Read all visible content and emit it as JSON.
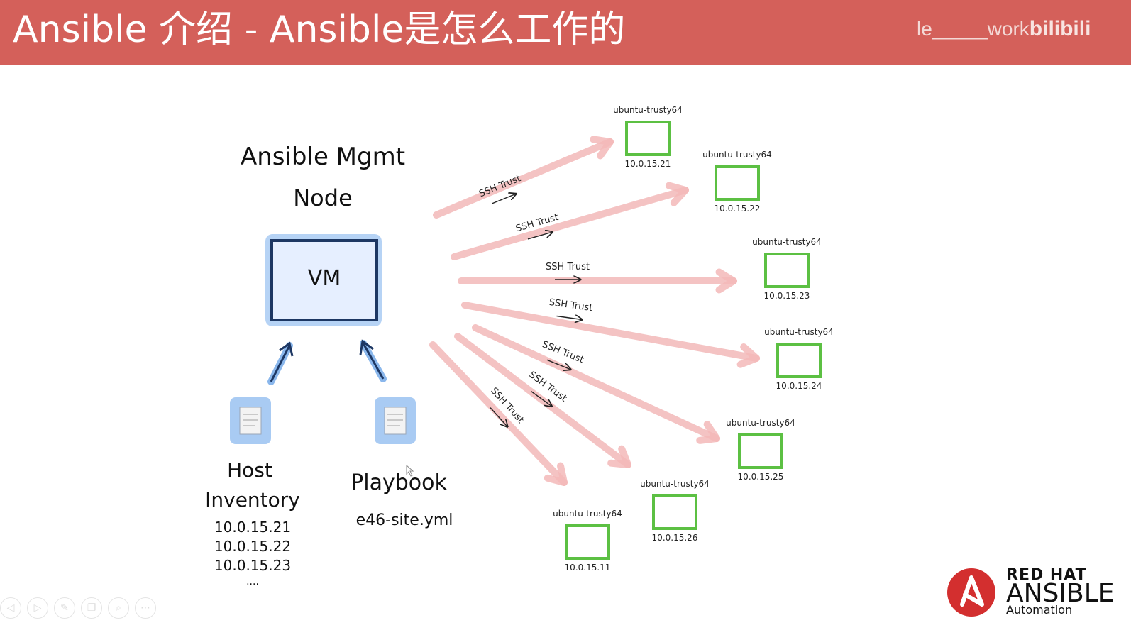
{
  "header": {
    "title": "Ansible 介绍 - Ansible是怎么工作的",
    "watermark_user": "le_____work",
    "watermark_site": "bilibili"
  },
  "diagram": {
    "mgmt_label_line1": "Ansible Mgmt",
    "mgmt_label_line2": "Node",
    "vm_label": "VM",
    "inventory": {
      "label_line1": "Host",
      "label_line2": "Inventory",
      "hosts": [
        "10.0.15.21",
        "10.0.15.22",
        "10.0.15.23",
        "...."
      ]
    },
    "playbook": {
      "label": "Playbook",
      "file": "e46-site.yml"
    },
    "connection_label": "SSH Trust",
    "nodes": [
      {
        "name": "ubuntu-trusty64",
        "ip": "10.0.15.21"
      },
      {
        "name": "ubuntu-trusty64",
        "ip": "10.0.15.22"
      },
      {
        "name": "ubuntu-trusty64",
        "ip": "10.0.15.23"
      },
      {
        "name": "ubuntu-trusty64",
        "ip": "10.0.15.24"
      },
      {
        "name": "ubuntu-trusty64",
        "ip": "10.0.15.25"
      },
      {
        "name": "ubuntu-trusty64",
        "ip": "10.0.15.26"
      },
      {
        "name": "ubuntu-trusty64",
        "ip": "10.0.15.11"
      }
    ],
    "colors": {
      "connection": "#f3b9b9",
      "node_border": "#5cc043",
      "vm_glow": "#9cc3f0",
      "vm_border": "#1d3763",
      "vm_fill": "#e6efff"
    }
  },
  "brand": {
    "line1": "RED HAT",
    "line2": "ANSIBLE",
    "line3": "Automation"
  },
  "toolbar": {
    "icons": [
      "prev-icon",
      "play-icon",
      "pen-icon",
      "copy-icon",
      "zoom-icon",
      "more-icon"
    ]
  }
}
